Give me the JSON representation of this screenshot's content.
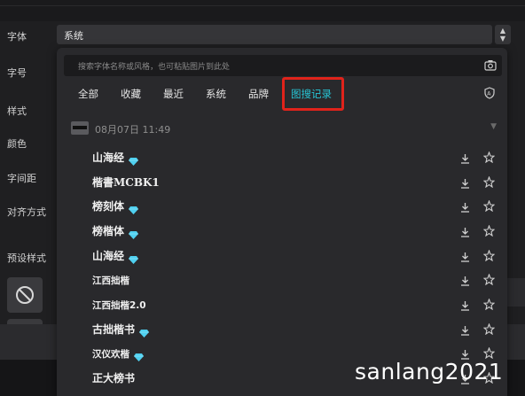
{
  "sidebar_labels": {
    "font": "字体",
    "size": "字号",
    "style": "样式",
    "color": "颜色",
    "spacing": "字间距",
    "align": "对齐方式",
    "preset": "预设样式"
  },
  "font_select": {
    "value": "系统"
  },
  "panel": {
    "search_placeholder": "搜索字体名称或风格，也可粘贴图片到此处",
    "tabs": [
      "全部",
      "收藏",
      "最近",
      "系统",
      "品牌",
      "图搜记录"
    ],
    "active_tab": "图搜记录",
    "date_header": "08月07日 11:49",
    "fonts": [
      {
        "name": "山海经",
        "vip": true
      },
      {
        "name": "楷書MCBK1",
        "vip": false
      },
      {
        "name": "榜刻体",
        "vip": true
      },
      {
        "name": "榜楷体",
        "vip": true
      },
      {
        "name": "山海经",
        "vip": true
      },
      {
        "name": "江西拙楷",
        "vip": false
      },
      {
        "name": "江西拙楷2.0",
        "vip": false
      },
      {
        "name": "古拙楷书",
        "vip": true
      },
      {
        "name": "汉仪欢楷",
        "vip": true
      },
      {
        "name": "正大榜书",
        "vip": false
      }
    ]
  },
  "colors": {
    "accent": "#27c6d6",
    "highlight_box": "#e0231b",
    "gem": "#4fd0f0"
  },
  "watermark": "sanlang2021"
}
